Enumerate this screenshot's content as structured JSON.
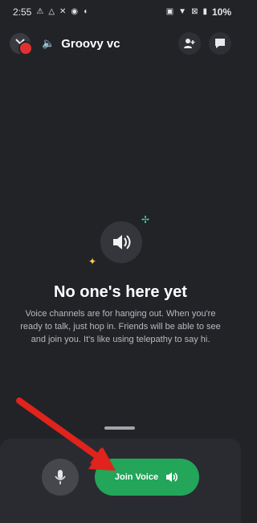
{
  "statusbar": {
    "time": "2:55",
    "left_icons": [
      "alert-icon",
      "signal-relay-icon",
      "missed-call-icon",
      "record-icon",
      "cast-icon"
    ],
    "right_icons": [
      "volte-icon",
      "wifi-icon",
      "no-sim-icon",
      "battery-icon"
    ],
    "battery": "10%"
  },
  "header": {
    "channel_name": "Groovy vc",
    "actions": [
      "add-user-icon",
      "chat-icon"
    ]
  },
  "empty_state": {
    "title": "No one's here yet",
    "text": "Voice channels are for hanging out. When you're ready to talk, just hop in. Friends will be able to see and join you. It's like using telepathy to say hi."
  },
  "bottom": {
    "join_label": "Join Voice"
  },
  "colors": {
    "background": "#222327",
    "join_green": "#23a55a",
    "arrow_red": "#e0231c"
  }
}
